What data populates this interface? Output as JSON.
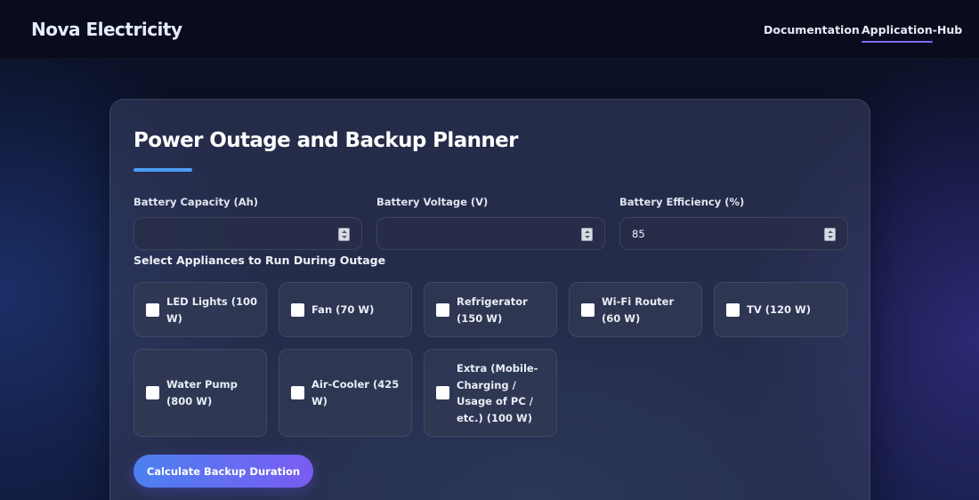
{
  "header": {
    "brand": "Nova Electricity",
    "nav": [
      {
        "label": "Documentation",
        "active": false
      },
      {
        "label": "Application-Hub",
        "active": true
      }
    ]
  },
  "planner": {
    "title": "Power Outage and Backup Planner",
    "fields": [
      {
        "label": "Battery Capacity (Ah)",
        "value": ""
      },
      {
        "label": "Battery Voltage (V)",
        "value": ""
      },
      {
        "label": "Battery Efficiency (%)",
        "value": "85"
      }
    ],
    "appliances_heading": "Select Appliances to Run During Outage",
    "appliances": [
      {
        "label": "LED Lights (100 W)",
        "checked": false
      },
      {
        "label": "Fan (70 W)",
        "checked": false
      },
      {
        "label": "Refrigerator (150 W)",
        "checked": false
      },
      {
        "label": "Wi-Fi Router (60 W)",
        "checked": false
      },
      {
        "label": "TV (120 W)",
        "checked": false
      },
      {
        "label": "Water Pump (800 W)",
        "checked": false
      },
      {
        "label": "Air-Cooler (425 W)",
        "checked": false
      },
      {
        "label": "Extra (Mobile-Charging / Usage of PC / etc.) (100 W)",
        "checked": false
      }
    ],
    "calculate_label": "Calculate Backup Duration"
  },
  "colors": {
    "accent": "#4b9df6",
    "nav_underline": "#7b6cf6",
    "button_start": "#4b80f0",
    "button_end": "#7a5cf2"
  }
}
